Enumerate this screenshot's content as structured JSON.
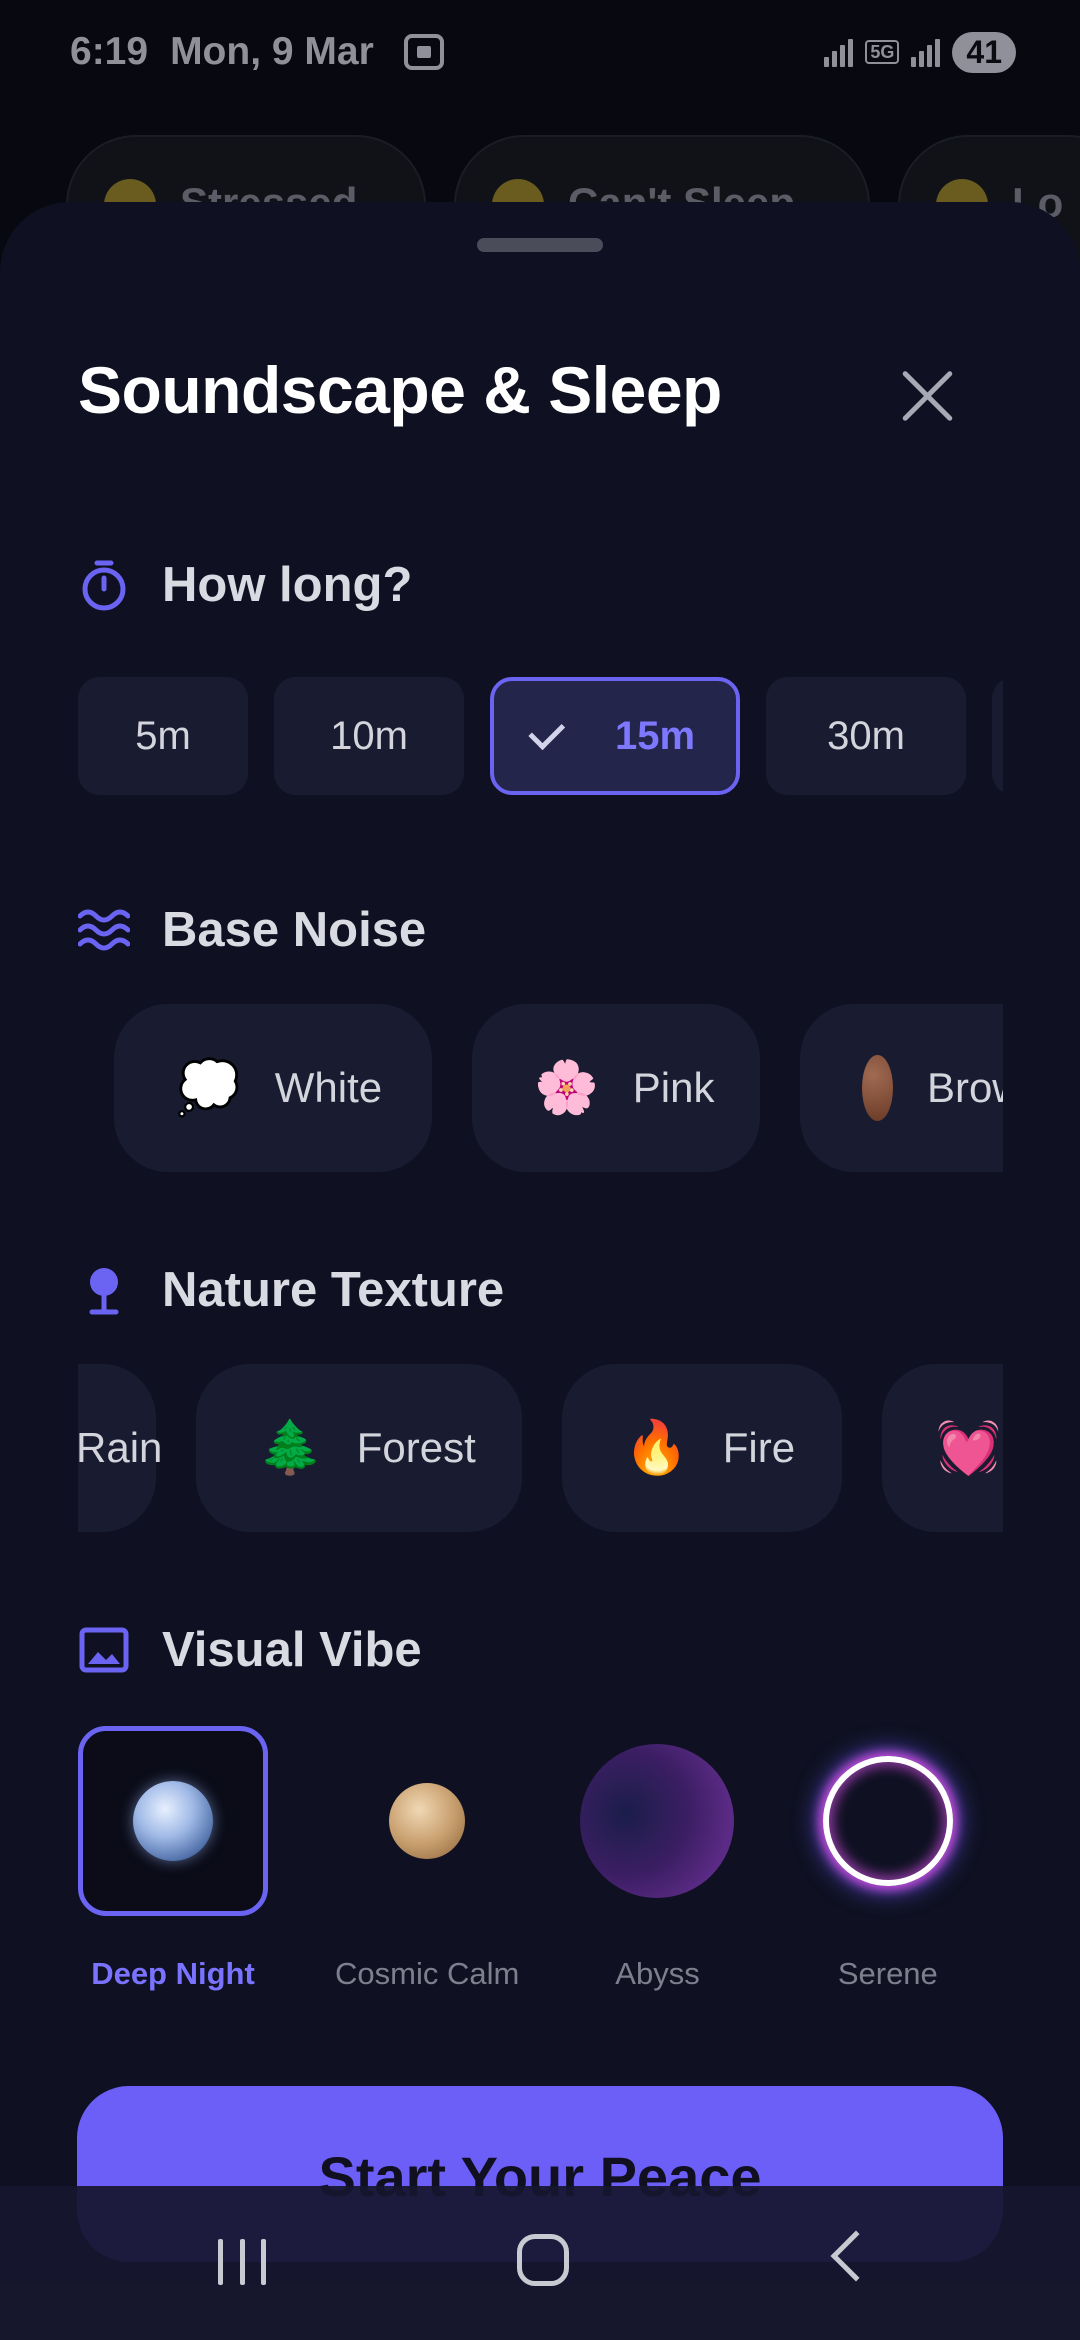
{
  "status_bar": {
    "time": "6:19",
    "date": "Mon, 9 Mar",
    "network": "5G",
    "battery": "41"
  },
  "background": {
    "chips": [
      {
        "label": "Stressed"
      },
      {
        "label": "Can't Sleep"
      },
      {
        "label": "Lo"
      }
    ]
  },
  "sheet": {
    "title": "Soundscape & Sleep",
    "duration": {
      "label": "How long?",
      "options": [
        "5m",
        "10m",
        "15m",
        "30m"
      ],
      "selected": "15m"
    },
    "base_noise": {
      "label": "Base Noise",
      "options": [
        {
          "label": "White",
          "icon": "💭"
        },
        {
          "label": "Pink",
          "icon": "🌸"
        },
        {
          "label": "Brown",
          "icon": "brown-circle"
        }
      ]
    },
    "nature_texture": {
      "label": "Nature Texture",
      "options": [
        {
          "label": "Rain"
        },
        {
          "label": "Forest",
          "icon": "🌲"
        },
        {
          "label": "Fire",
          "icon": "🔥"
        },
        {
          "label": "Heartbeat",
          "icon": "💓"
        }
      ]
    },
    "visual_vibe": {
      "label": "Visual Vibe",
      "options": [
        "Deep Night",
        "Cosmic Calm",
        "Abyss",
        "Serene"
      ],
      "selected": "Deep Night"
    },
    "cta_label": "Start Your Peace"
  },
  "colors": {
    "accent": "#6c5ff7",
    "sheet_bg": "#0f1122",
    "chip_bg": "#191c30"
  }
}
